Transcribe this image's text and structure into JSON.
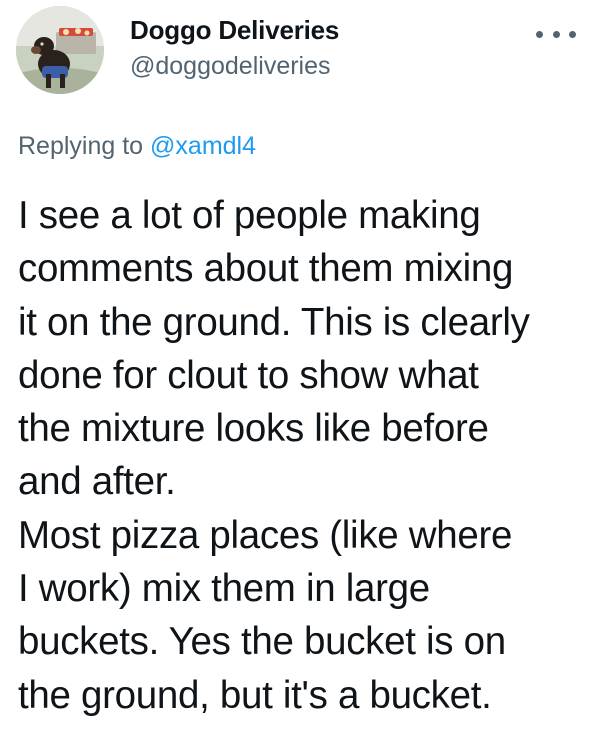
{
  "author": {
    "display_name": "Doggo Deliveries",
    "handle": "@doggodeliveries",
    "avatar_icon": "dog-with-pizza-box-avatar"
  },
  "menu": {
    "icon": "more-options-icon"
  },
  "reply": {
    "prefix": "Replying to ",
    "mention": "@xamdl4"
  },
  "body": {
    "lines": [
      "I see a lot of people making",
      "comments about them mixing",
      "it on the ground. This is clearly",
      "done for clout to show what",
      "the mixture looks like before",
      "and after.",
      "Most pizza places (like where",
      "I work) mix them in large",
      "buckets. Yes the bucket is on",
      "the ground, but it's a bucket."
    ]
  },
  "colors": {
    "text": "#0f1419",
    "secondary": "#536471",
    "link": "#1d9bf0"
  }
}
